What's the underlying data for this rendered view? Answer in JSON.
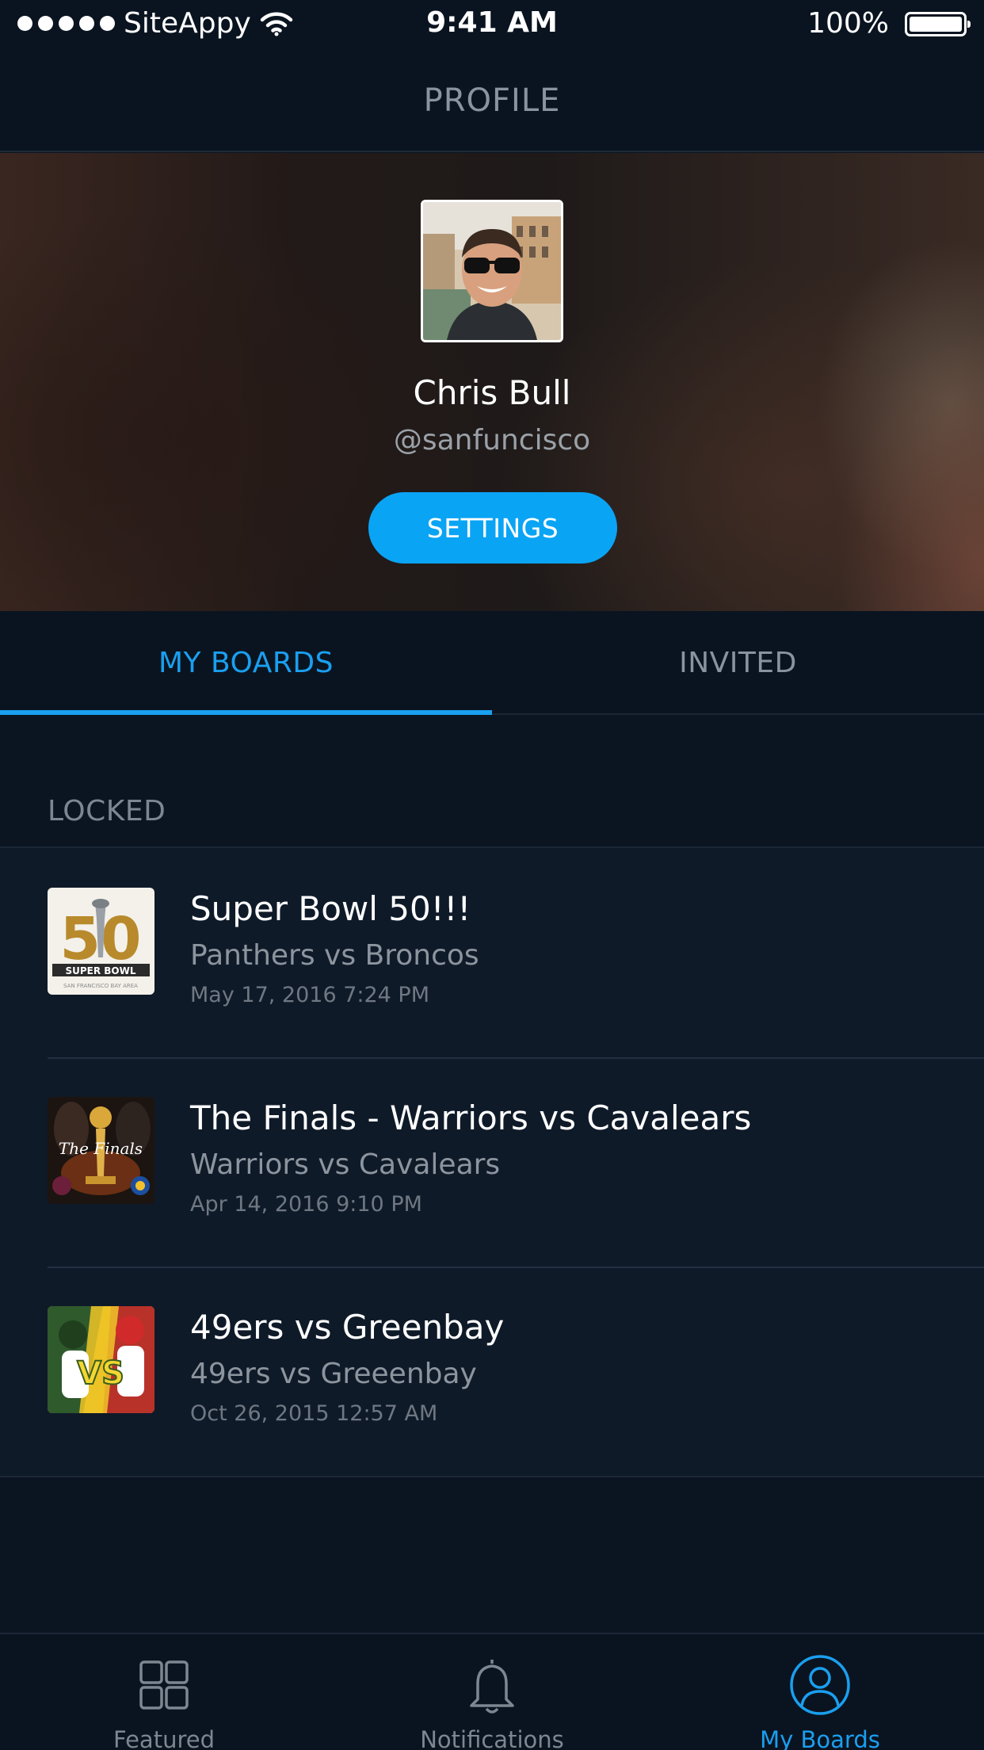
{
  "status_bar": {
    "carrier": "SiteAppy",
    "time": "9:41 AM",
    "battery": "100%"
  },
  "nav": {
    "title": "PROFILE"
  },
  "profile": {
    "name": "Chris Bull",
    "handle": "@sanfuncisco",
    "settings_label": "SETTINGS"
  },
  "tabs": [
    {
      "label": "MY BOARDS",
      "active": true
    },
    {
      "label": "INVITED",
      "active": false
    }
  ],
  "section": {
    "title": "LOCKED"
  },
  "boards": [
    {
      "title": "Super Bowl 50!!!",
      "subtitle": "Panthers vs Broncos",
      "date": "May 17, 2016 7:24 PM",
      "thumb_icon": "super-bowl-logo"
    },
    {
      "title": "The Finals - Warriors vs Cavalears",
      "subtitle": "Warriors vs Cavalears",
      "date": "Apr 14, 2016 9:10 PM",
      "thumb_icon": "nba-finals-logo"
    },
    {
      "title": "49ers vs Greenbay",
      "subtitle": "49ers vs Greeenbay",
      "date": "Oct 26, 2015 12:57 AM",
      "thumb_icon": "matchup-image"
    }
  ],
  "tabbar": [
    {
      "label": "Featured",
      "icon": "grid-icon",
      "active": false
    },
    {
      "label": "Notifications",
      "icon": "bell-icon",
      "active": false
    },
    {
      "label": "My Boards",
      "icon": "user-icon",
      "active": true
    }
  ],
  "colors": {
    "accent": "#1a9ff0",
    "button": "#0aa4f5",
    "background": "#0b1522",
    "list_bg": "#0f1a29"
  }
}
